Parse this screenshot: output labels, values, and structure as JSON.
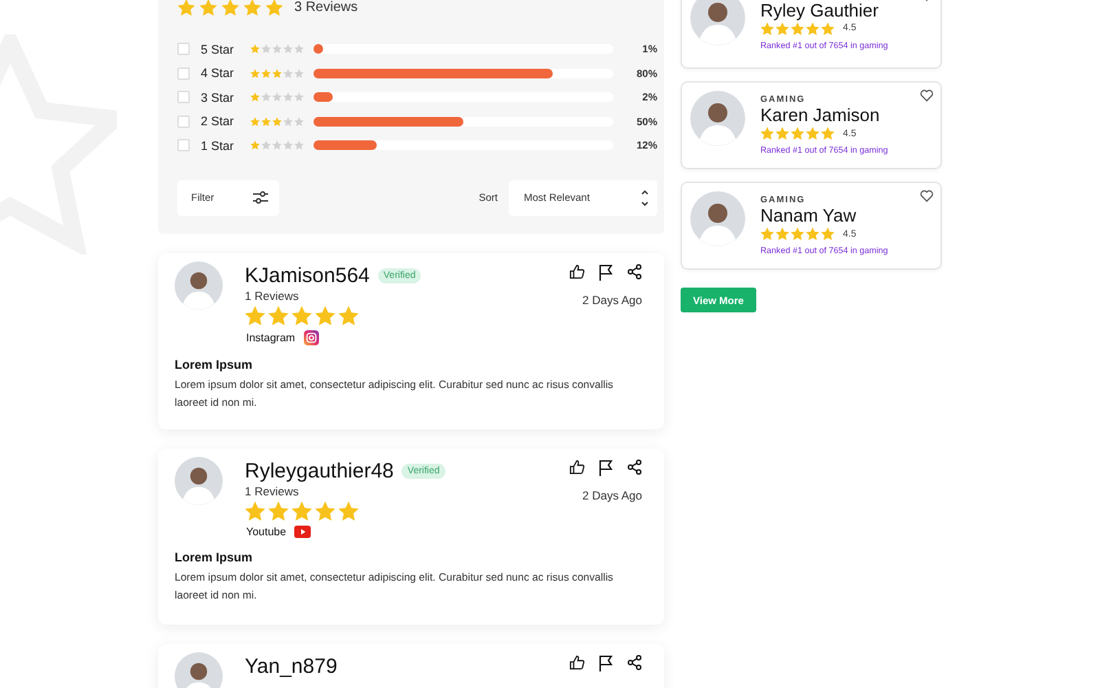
{
  "summary": {
    "stars": 5,
    "count": "3 Reviews",
    "breakdown": [
      {
        "label": "5 Star",
        "checked": false,
        "stars": 1,
        "level": 0.03,
        "percent": "1%"
      },
      {
        "label": "4 Star",
        "checked": false,
        "stars": 3,
        "level": 0.8,
        "percent": "80%"
      },
      {
        "label": "3 Star",
        "checked": false,
        "stars": 1,
        "level": 0.065,
        "percent": "2%"
      },
      {
        "label": "2 Star",
        "checked": false,
        "stars": 3,
        "level": 0.5,
        "percent": "50%"
      },
      {
        "label": "1 Star",
        "checked": false,
        "stars": 1,
        "level": 0.21,
        "percent": "12%"
      }
    ],
    "filter": {
      "label": "Filter"
    },
    "sort": {
      "label": "Sort",
      "value": "Most Relevant"
    }
  },
  "reviews": [
    {
      "username": "KJamison564",
      "badge": "Verified",
      "review_count": "1 Reviews",
      "stars": 5,
      "platform": {
        "name": "Instagram",
        "kind": "instagram"
      },
      "date": "2 Days Ago",
      "title": "Lorem Ipsum",
      "body": "Lorem ipsum dolor sit amet, consectetur adipiscing elit. Curabitur sed nunc ac risus convallis laoreet id non mi."
    },
    {
      "username": "Ryleygauthier48",
      "badge": "Verified",
      "review_count": "1 Reviews",
      "stars": 5,
      "platform": {
        "name": "Youtube",
        "kind": "youtube"
      },
      "date": "2 Days Ago",
      "title": "Lorem Ipsum",
      "body": "Lorem ipsum dolor sit amet, consectetur adipiscing elit. Curabitur sed nunc ac risus convallis laoreet id non mi."
    },
    {
      "username": "Yan_n879"
    }
  ],
  "creators": [
    {
      "name": "Ryley Gauthier",
      "stars": 5,
      "rating": "4.5",
      "rank": "Ranked #1 out of 7654 in gaming"
    },
    {
      "category": "GAMING",
      "name": "Karen Jamison",
      "stars": 5,
      "rating": "4.5",
      "rank": "Ranked #1 out of 7654 in gaming"
    },
    {
      "category": "GAMING",
      "name": "Nanam Yaw",
      "stars": 5,
      "rating": "4.5",
      "rank": "Ranked #1 out of 7654 in gaming"
    }
  ],
  "view_more": "View More"
}
